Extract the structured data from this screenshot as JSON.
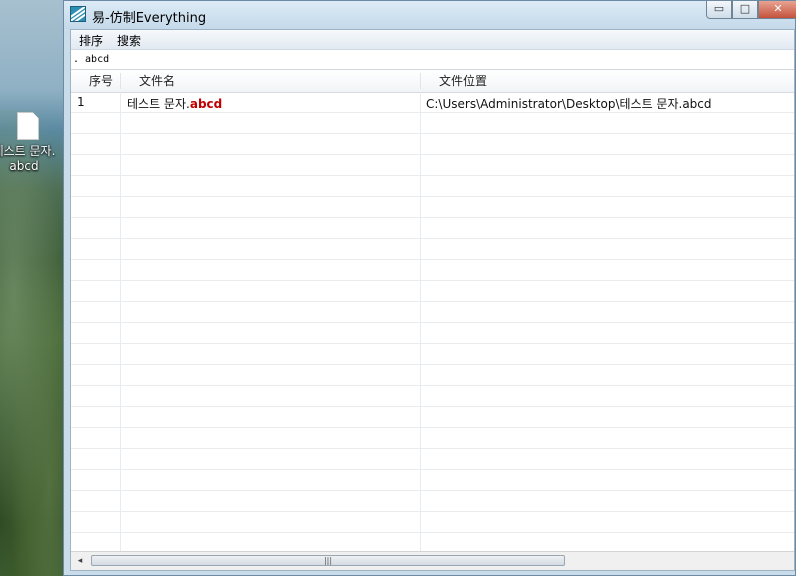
{
  "desktop": {
    "icon_label_line1": "테스트 문자.",
    "icon_label_line2": "abcd"
  },
  "window": {
    "title": "易-仿制Everything",
    "btn_min": "▭",
    "btn_max": "□",
    "btn_close": "✕"
  },
  "menu": {
    "items": [
      "排序",
      "搜索"
    ]
  },
  "search": {
    "value": ". abcd"
  },
  "table": {
    "columns": [
      "序号",
      "文件名",
      "文件位置"
    ],
    "rows": [
      {
        "index": "1",
        "name_prefix": "테스트 문자.",
        "name_match": "abcd",
        "path": "C:\\Users\\Administrator\\Desktop\\테스트 문자.abcd"
      }
    ]
  },
  "scrollbar": {
    "left_arrow": "◂",
    "grip": "|||"
  },
  "colors": {
    "match_highlight": "#c00000",
    "app_icon": "#2f8fb3"
  }
}
